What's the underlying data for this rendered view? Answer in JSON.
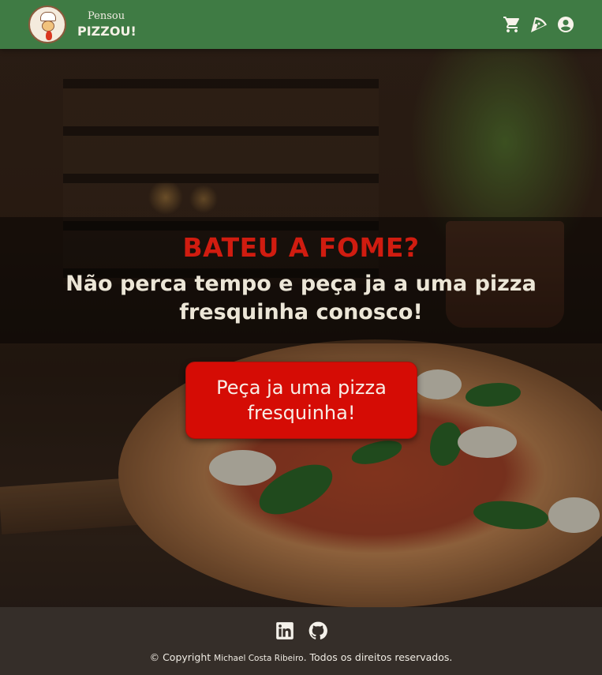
{
  "header": {
    "brand_small": "Pensou",
    "brand_big": "PIZZOU!",
    "logo_icon": "chef-logo-icon",
    "nav": [
      {
        "icon": "cart-icon",
        "label": "Carrinho"
      },
      {
        "icon": "pizza-slice-icon",
        "label": "Cardápio"
      },
      {
        "icon": "user-icon",
        "label": "Conta"
      }
    ],
    "color": "#3f7b44"
  },
  "hero": {
    "title": "BATEU A FOME?",
    "subtitle": "Não perca tempo e peça ja a uma pizza fresquinha conosco!",
    "cta_label": "Peça ja uma pizza fresquinha!",
    "title_color": "#d01c10",
    "cta_color": "#d50c05"
  },
  "footer": {
    "socials": [
      {
        "icon": "linkedin-icon"
      },
      {
        "icon": "github-icon"
      }
    ],
    "copyright_prefix": "© Copyright",
    "copyright_author": "Michael Costa Ribeiro",
    "copyright_suffix": ". Todos os direitos reservados."
  }
}
